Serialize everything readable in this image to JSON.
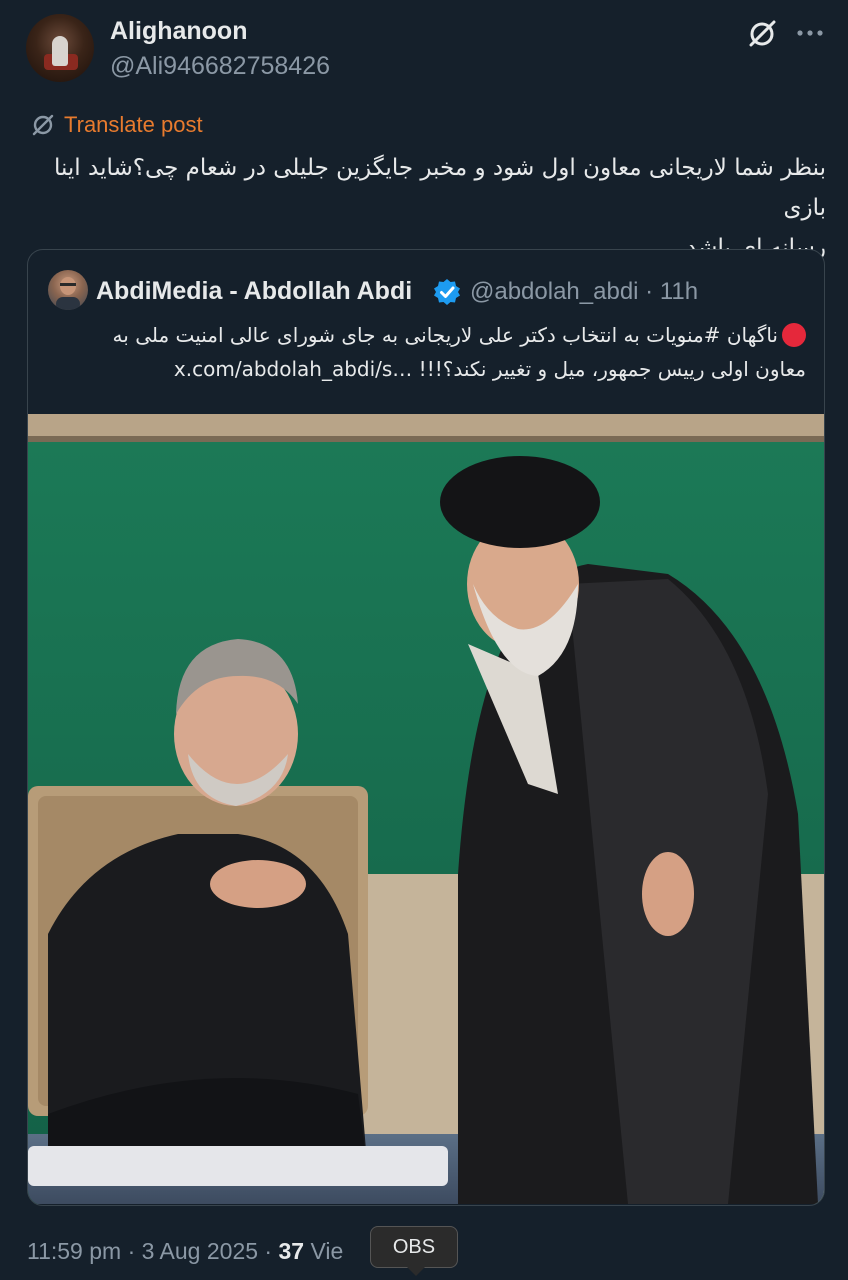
{
  "post": {
    "author": {
      "display_name": "Alighanoon",
      "handle": "@Ali946682758426"
    },
    "translate_label": "Translate post",
    "text_line1": "بنظر شما لاریجانی معاون اول شود و مخبر جایگزین جلیلی در شعام چی؟شاید اینا بازی",
    "text_line2": "رسانه ای باشد.",
    "timestamp": "11:59 pm · 3 Aug 2025 · ",
    "views_count": "37",
    "views_label": " Vie"
  },
  "quoted": {
    "display_name": "AbdiMedia - Abdollah Abdi",
    "handle_time": "@abdolah_abdi · 11h",
    "text_line1": "ناگهان #منویات به انتخاب دکتر علی لاریجانی به جای شورای عالی امنیت ملی به",
    "text_line2_fa": "معاون اولی رییس جمهور، میل و تغییر نکند؟!!!",
    "text_link": "x.com/abdolah_abdi/s…"
  },
  "tooltip": {
    "label": "OBS"
  },
  "colors": {
    "background": "#15202b",
    "primary_text": "#e7e9ea",
    "secondary_text": "#8b98a5",
    "translate_accent": "#e87b2e",
    "verified_blue": "#1d9bf0",
    "red_dot": "#e5283b"
  },
  "icons": {
    "grok": "grok-icon",
    "more": "more-icon",
    "translate": "translate-icon",
    "verified": "verified-badge-icon"
  }
}
